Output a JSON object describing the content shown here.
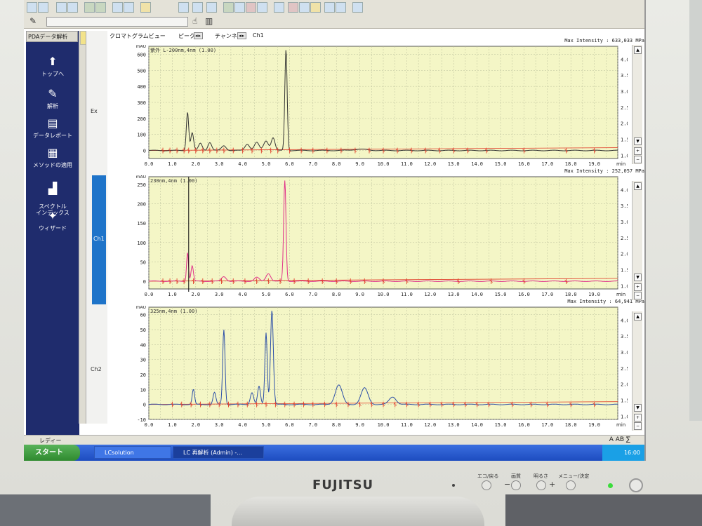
{
  "window": {
    "left_panel_title": "PDAデータ解析",
    "nav_items": [
      "トップへ",
      "解析",
      "データレポート",
      "メソッドの適用",
      "スペクトル\nインデックス",
      "ウィザード"
    ],
    "side_labels": [
      "Ex",
      "Ch1",
      "Ch2"
    ],
    "tabs": {
      "chromatogram": "クロマトグラムビュー",
      "peak": "ピーク",
      "channel": "チャンネル",
      "channel_value": "Ch1"
    },
    "status_text": "レディー",
    "status_icons": "A AB ∑"
  },
  "taskbar": {
    "start": "スタート",
    "tasks": [
      "LCsolution",
      "LC 再解析 (Admin) -..."
    ],
    "clock": "16:00"
  },
  "monitor": {
    "brand": "FUJITSU",
    "buttons": [
      "エコ/戻る",
      "画質",
      "明るさ",
      "メニュー/決定"
    ],
    "signs": [
      "−",
      "+"
    ]
  },
  "chart_data": [
    {
      "type": "line",
      "panel": "Ex",
      "legend": "紫外 L-200nm,4nm (1.00)",
      "max_intensity": "Max Intensity : 633,033 MPa",
      "yunit": "mAU",
      "xunit": "min",
      "y2unit": "MPa",
      "xlim": [
        0,
        20
      ],
      "ylim": [
        -50,
        650
      ],
      "y2lim": [
        0.9,
        4.4
      ],
      "xticks": [
        0.0,
        1.0,
        2.0,
        3.0,
        4.0,
        5.0,
        6.0,
        7.0,
        8.0,
        9.0,
        10.0,
        11.0,
        12.0,
        13.0,
        14.0,
        15.0,
        16.0,
        17.0,
        18.0,
        19.0
      ],
      "yticks": [
        0,
        100,
        200,
        300,
        400,
        500,
        600
      ],
      "y2ticks": [
        1.0,
        1.5,
        2.0,
        2.5,
        3.0,
        3.5,
        4.0
      ],
      "color": "#333333",
      "baseline_color": "#e0402c",
      "peaks": [
        [
          1.65,
          240,
          0.05
        ],
        [
          1.85,
          110,
          0.06
        ],
        [
          2.2,
          45,
          0.08
        ],
        [
          2.6,
          50,
          0.08
        ],
        [
          3.2,
          30,
          0.1
        ],
        [
          4.2,
          40,
          0.1
        ],
        [
          4.6,
          50,
          0.1
        ],
        [
          5.0,
          60,
          0.1
        ],
        [
          5.3,
          80,
          0.08
        ],
        [
          5.85,
          630,
          0.05
        ],
        [
          9.0,
          8,
          0.3
        ]
      ],
      "markers": [
        0.6,
        0.9,
        1.2,
        1.5,
        1.7,
        2.0,
        2.3,
        2.6,
        2.9,
        3.2,
        3.6,
        4.0,
        4.4,
        4.8,
        5.2,
        5.5,
        6.0,
        6.5,
        7.0,
        7.6,
        8.2,
        8.8,
        9.4,
        10.0,
        10.6,
        11.2,
        11.8,
        12.4,
        13.0,
        13.6,
        14.4,
        16.0,
        17.8,
        19.0
      ],
      "xlabel": "min",
      "ylabel": "mAU"
    },
    {
      "type": "line",
      "panel": "Ch1",
      "legend": "230nm,4nm (1.00)",
      "max_intensity": "Max Intensity : 252,057 MPa",
      "yunit": "mAU",
      "xunit": "min",
      "y2unit": "MPa",
      "xlim": [
        0,
        20
      ],
      "ylim": [
        -20,
        270
      ],
      "y2lim": [
        0.9,
        4.4
      ],
      "xticks": [
        0.0,
        1.0,
        2.0,
        3.0,
        4.0,
        5.0,
        6.0,
        7.0,
        8.0,
        9.0,
        10.0,
        11.0,
        12.0,
        13.0,
        14.0,
        15.0,
        16.0,
        17.0,
        18.0,
        19.0
      ],
      "yticks": [
        0,
        50,
        100,
        150,
        200,
        250
      ],
      "y2ticks": [
        1.0,
        1.5,
        2.0,
        2.5,
        3.0,
        3.5,
        4.0
      ],
      "color": "#e0308a",
      "baseline_color": "#e0402c",
      "cursor_x": 1.7,
      "peaks": [
        [
          1.65,
          75,
          0.04
        ],
        [
          1.85,
          40,
          0.05
        ],
        [
          3.2,
          12,
          0.1
        ],
        [
          4.6,
          10,
          0.1
        ],
        [
          5.1,
          20,
          0.1
        ],
        [
          5.8,
          260,
          0.05
        ]
      ],
      "markers": [
        0.6,
        0.9,
        1.2,
        1.5,
        1.9,
        2.3,
        2.7,
        3.1,
        3.6,
        4.1,
        4.6,
        5.1,
        5.6,
        6.2,
        6.8,
        7.4,
        8.0,
        8.6,
        9.2,
        10.0,
        11.0,
        13.2,
        14.6,
        16.0,
        17.8
      ],
      "xlabel": "min",
      "ylabel": "mAU"
    },
    {
      "type": "line",
      "panel": "Ch2",
      "legend": "325nm,4nm (1.00)",
      "max_intensity": "Max Intensity : 64,941 MPa",
      "yunit": "mAU",
      "xunit": "min",
      "y2unit": "MPa",
      "xlim": [
        0,
        20
      ],
      "ylim": [
        -10,
        65
      ],
      "y2lim": [
        0.9,
        4.4
      ],
      "xticks": [
        0.0,
        1.0,
        2.0,
        3.0,
        4.0,
        5.0,
        6.0,
        7.0,
        8.0,
        9.0,
        10.0,
        11.0,
        12.0,
        13.0,
        14.0,
        15.0,
        16.0,
        17.0,
        18.0,
        19.0
      ],
      "yticks": [
        -10,
        0,
        10,
        20,
        30,
        40,
        50,
        60
      ],
      "y2ticks": [
        1.0,
        1.5,
        2.0,
        2.5,
        3.0,
        3.5,
        4.0
      ],
      "color": "#2c4fa8",
      "baseline_color": "#e0402c",
      "peaks": [
        [
          1.9,
          10,
          0.05
        ],
        [
          2.8,
          8,
          0.06
        ],
        [
          3.2,
          50,
          0.05
        ],
        [
          4.4,
          8,
          0.07
        ],
        [
          4.7,
          12,
          0.06
        ],
        [
          5.0,
          48,
          0.05
        ],
        [
          5.25,
          63,
          0.06
        ],
        [
          8.1,
          13,
          0.15
        ],
        [
          9.2,
          11,
          0.15
        ],
        [
          10.4,
          5,
          0.15
        ]
      ],
      "markers": [
        1.0,
        1.4,
        1.8,
        2.2,
        2.6,
        3.0,
        3.4,
        3.8,
        4.2,
        4.6,
        5.0,
        5.4,
        5.8,
        6.2,
        6.6,
        7.0,
        7.5,
        8.0,
        8.5,
        9.0,
        9.5,
        10.0,
        10.5,
        11.0,
        11.5,
        12.0,
        12.5,
        13.0,
        13.5,
        14.0,
        14.5,
        15.5,
        16.3,
        17.0,
        18.0,
        19.0
      ],
      "xlabel": "min",
      "ylabel": "mAU"
    }
  ]
}
